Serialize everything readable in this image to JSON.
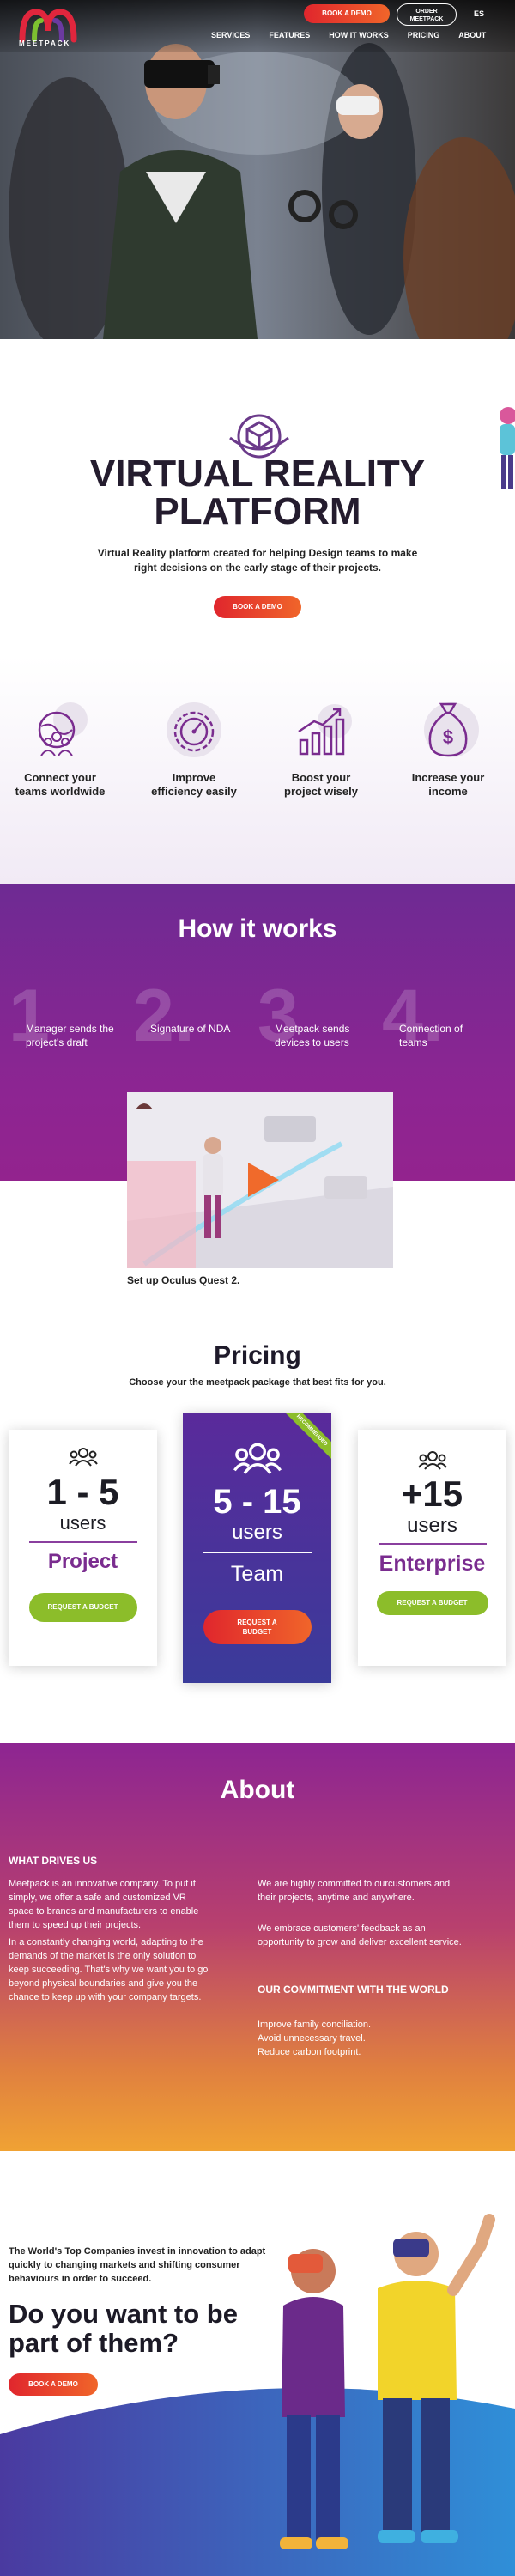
{
  "nav": {
    "logo_text": "MEETPACK",
    "book_demo": "BOOK A DEMO",
    "order_line1": "ORDER",
    "order_line2": "MEETPACK",
    "lang": "ES",
    "links": [
      "SERVICES",
      "FEATURES",
      "HOW IT WORKS",
      "PRICING",
      "ABOUT"
    ]
  },
  "intro": {
    "title_line1": "VIRTUAL REALITY",
    "title_line2": "PLATFORM",
    "subtitle": "Virtual Reality platform created for helping Design teams to make right decisions on the early stage of their projects.",
    "button": "BOOK A DEMO"
  },
  "features": [
    {
      "icon": "globe-people-icon",
      "line1": "Connect your",
      "line2": "teams worldwide"
    },
    {
      "icon": "gear-gauge-icon",
      "line1": "Improve",
      "line2": "efficiency easily"
    },
    {
      "icon": "growth-chart-icon",
      "line1": "Boost your",
      "line2": "project wisely"
    },
    {
      "icon": "money-bag-icon",
      "line1": "Increase your",
      "line2": "income"
    }
  ],
  "how": {
    "title": "How it works",
    "steps": [
      {
        "num": "1",
        "text": "Manager sends the project's draft"
      },
      {
        "num": "2.",
        "text": "Signature of NDA"
      },
      {
        "num": "3",
        "text": "Meetpack sends devices to users"
      },
      {
        "num": "4.",
        "text": "Connection of teams"
      }
    ],
    "video_caption": "Set up Oculus Quest 2."
  },
  "pricing": {
    "title": "Pricing",
    "subtitle": "Choose your the meetpack package that best fits for you.",
    "cards": [
      {
        "range": "1 - 5",
        "users": "users",
        "plan": "Project",
        "button": "REQUEST A BUDGET"
      },
      {
        "range": "5 - 15",
        "users": "users",
        "plan": "Team",
        "button": "REQUEST A BUDGET",
        "ribbon": "RECOMMENDED"
      },
      {
        "range": "+15",
        "users": "users",
        "plan": "Enterprise",
        "button": "REQUEST A BUDGET"
      }
    ]
  },
  "about": {
    "title": "About",
    "what_heading": "WHAT DRIVES US",
    "what_p1": "Meetpack is an innovative company. To put it simply, we offer a safe and customized VR space to brands and manufacturers to enable them to speed up their projects.",
    "what_p2": "In a constantly changing world, adapting to the demands of the market is the only solution to keep succeeding. That's why we want you to go beyond physical boundaries and give you the chance to keep up with your company targets.",
    "right_p1": "We are highly committed to ourcustomers and their projects, anytime and anywhere.",
    "right_p2": "We embrace customers' feedback as an opportunity to grow and deliver excellent service.",
    "commit_heading": "OUR COMMITMENT WITH THE WORLD",
    "commit_items": [
      "Improve family conciliation.",
      "Avoid unnecessary travel.",
      "Reduce carbon footprint."
    ]
  },
  "cta": {
    "text": "The World's Top Companies invest in innovation to adapt quickly to changing markets and shifting consumer behaviours in order to succeed.",
    "title": "Do you want to be part of them?",
    "button": "BOOK A DEMO"
  }
}
